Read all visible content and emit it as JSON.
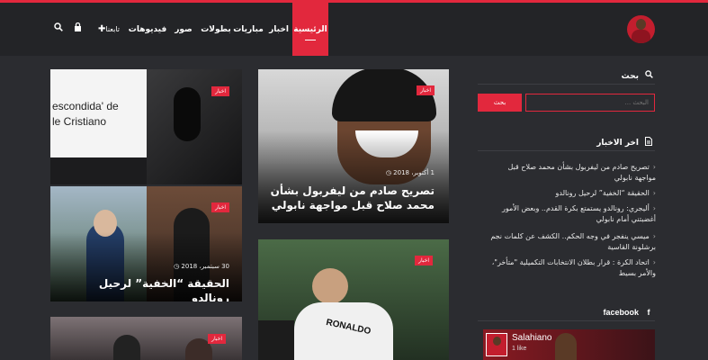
{
  "brand": {
    "accent": "#e2283d",
    "header_bg": "#232427",
    "page_bg": "#2b2c30"
  },
  "logo": {
    "icon": "salah-logo"
  },
  "nav": {
    "items": [
      {
        "label": "الرئيسية",
        "active": true
      },
      {
        "label": "اخبار"
      },
      {
        "label": "مباريات"
      },
      {
        "label": "بطولات"
      },
      {
        "label": "صور"
      },
      {
        "label": "فيديوهات"
      },
      {
        "label": "تابعنا"
      }
    ],
    "plus_icon": "plus-icon",
    "lock_icon": "lock-icon",
    "search_icon": "search-icon"
  },
  "cards": [
    {
      "badge": "اخبار",
      "image_text": "escondida' de\nle Cristiano"
    },
    {
      "badge": "اخبار",
      "date": "1 أكتوبر، 2018",
      "title": "تصريح صادم من ليفربول بشأن محمد صلاح قبل مواجهة نابولي"
    },
    {
      "badge": "اخبار",
      "date": "30 سبتمبر، 2018",
      "title": "الحقيقة “الخفية” لرحيل رونالدو"
    },
    {
      "badge": "اخبار",
      "jersey_text": "RONALDO"
    },
    {
      "badge": "اخبار"
    }
  ],
  "sidebar": {
    "search": {
      "heading": "بحث",
      "placeholder": "البحث ...",
      "button": "بحث"
    },
    "latest": {
      "heading": "اخر الاخبار",
      "items": [
        "تصريح صادم من ليفربول بشأن محمد صلاح قبل مواجهة نابولي",
        "الحقيقة “الخفية” لرحيل رونالدو",
        "أليجري: رونالدو يستمتع بكرة القدم.. وبعض الأمور أغضبتني أمام نابولي",
        "ميسي ينفجر في وجه الحكم.. الكشف عن كلمات نجم برشلونة القاسية",
        "اتحاد الكرة : قرار بطلان الانتخابات التكميلية \"متأخر\"، والأمر بسيط"
      ]
    },
    "facebook": {
      "heading": "facebook",
      "page_name": "Salahiano",
      "likes": "1 like"
    }
  }
}
